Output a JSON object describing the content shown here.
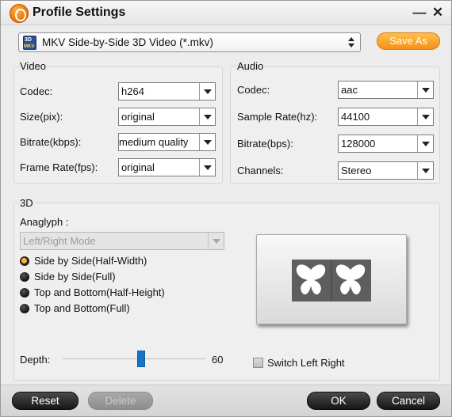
{
  "window": {
    "title": "Profile Settings",
    "minimize_glyph": "—",
    "close_glyph": "✕",
    "logo_icon": "app-logo-icon"
  },
  "profile": {
    "value": "MKV Side-by-Side 3D Video (*.mkv)",
    "icon": "mkv-3d-icon",
    "save_as_label": "Save As"
  },
  "video": {
    "title": "Video",
    "codec": {
      "label": "Codec:",
      "value": "h264"
    },
    "size": {
      "label": "Size(pix):",
      "value": "original"
    },
    "bitrate": {
      "label": "Bitrate(kbps):",
      "value": "medium quality"
    },
    "frame_rate": {
      "label": "Frame Rate(fps):",
      "value": "original"
    }
  },
  "audio": {
    "title": "Audio",
    "codec": {
      "label": "Codec:",
      "value": "aac"
    },
    "sample_rate": {
      "label": "Sample Rate(hz):",
      "value": "44100"
    },
    "bitrate": {
      "label": "Bitrate(bps):",
      "value": "128000"
    },
    "channels": {
      "label": "Channels:",
      "value": "Stereo"
    }
  },
  "three_d": {
    "title": "3D",
    "anaglyph_label": "Anaglyph :",
    "anaglyph_value": "Left/Right Mode",
    "options": [
      {
        "label": "Side by Side(Half-Width)",
        "checked": true
      },
      {
        "label": "Side by Side(Full)",
        "checked": false
      },
      {
        "label": "Top and Bottom(Half-Height)",
        "checked": false
      },
      {
        "label": "Top and Bottom(Full)",
        "checked": false
      }
    ],
    "preview_icon": "butterfly-side-by-side-preview",
    "depth_label": "Depth:",
    "depth_value": "60",
    "depth_fraction": 0.55,
    "switch_label": "Switch Left Right",
    "switch_checked": false
  },
  "footer": {
    "reset": "Reset",
    "delete": "Delete",
    "ok": "OK",
    "cancel": "Cancel"
  },
  "colors": {
    "accent_orange": "#f3901a",
    "slider_blue": "#1a73c9",
    "button_dark": "#161616"
  }
}
